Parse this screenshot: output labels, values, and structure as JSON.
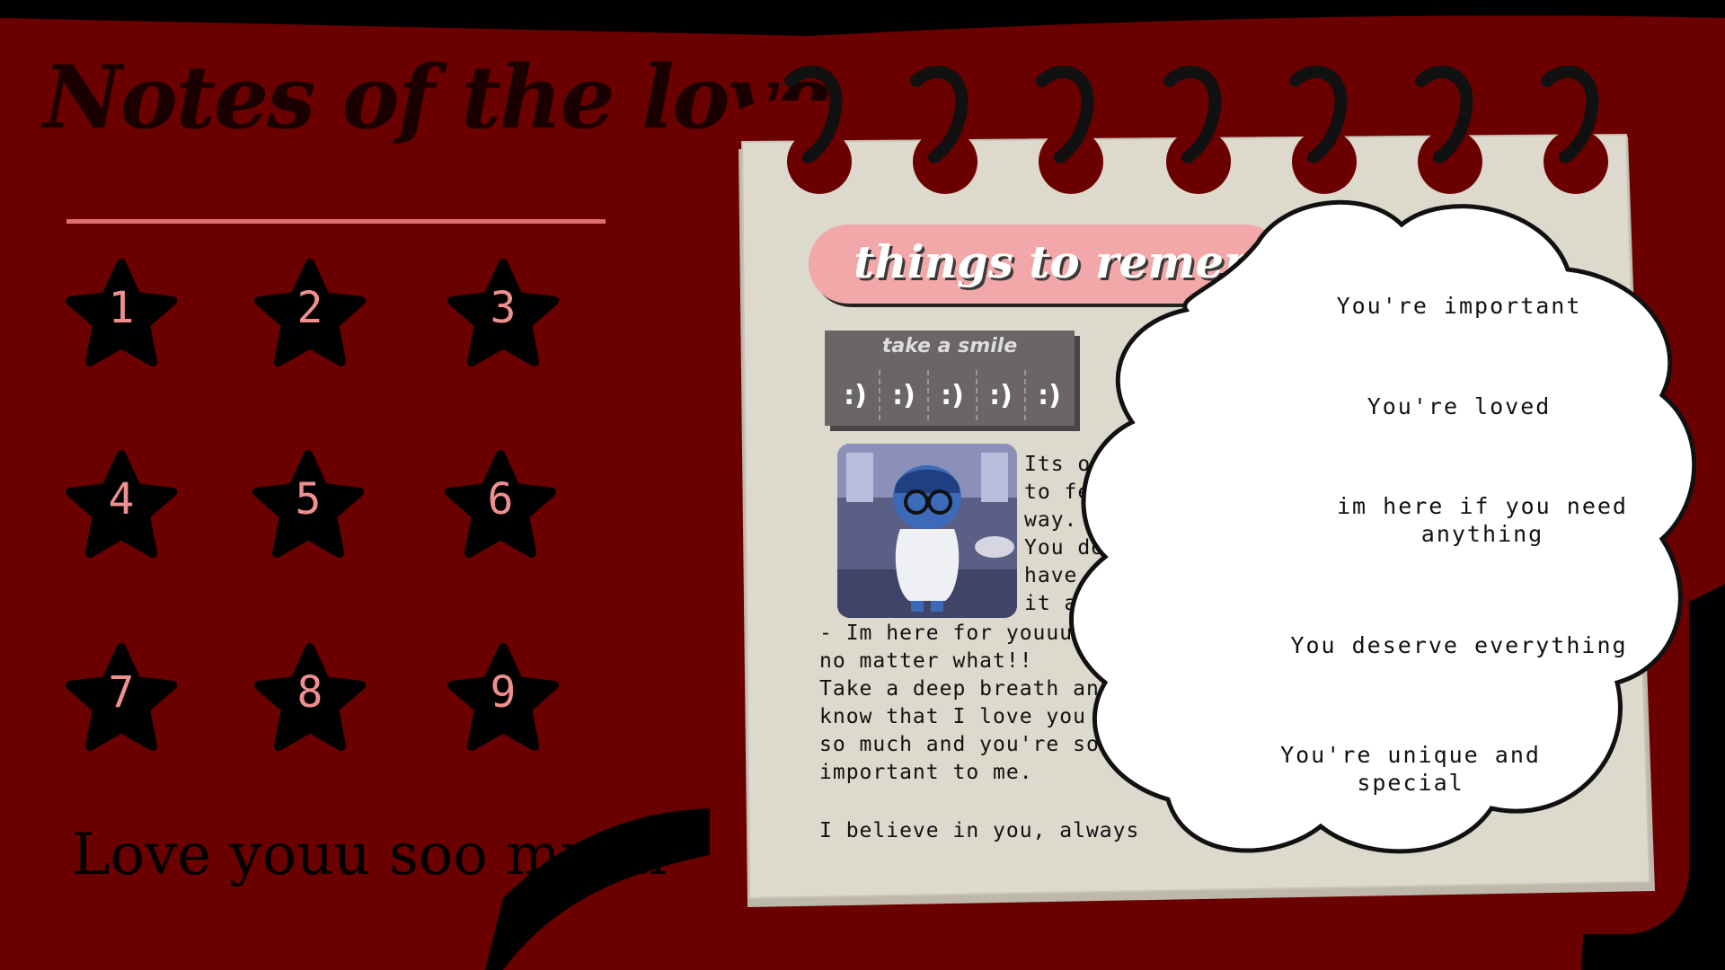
{
  "header": {
    "title": "Notes of the love"
  },
  "stars": [
    {
      "label": "1"
    },
    {
      "label": "2"
    },
    {
      "label": "3"
    },
    {
      "label": "4"
    },
    {
      "label": "5"
    },
    {
      "label": "6"
    },
    {
      "label": "7"
    },
    {
      "label": "8"
    },
    {
      "label": "9"
    }
  ],
  "footer": {
    "message": "Love youu soo much"
  },
  "notebook": {
    "banner": "things to remember",
    "smile_box": {
      "title": "take a smile",
      "tabs": [
        ":)",
        ":)",
        ":)",
        ":)",
        ":)"
      ]
    },
    "note_beside_image": "Its okay\nto feel this\nway.\nYou don't\nhave to face\nit alone",
    "note_body": "- Im here for youuu,\nno matter what!!\nTake a deep breath and\nknow that I love you\nso much and you're so\nimportant to me.",
    "note_closing": "I believe in you, always"
  },
  "cloud": {
    "messages": [
      "You're important",
      "You're loved",
      "im here if you need anything",
      "You deserve everything",
      "You're unique and special"
    ]
  },
  "colors": {
    "background_red": "#6b0000",
    "accent_pink": "#f2a7a8",
    "star_number": "#f08f8f",
    "paper": "#ddd9cd"
  },
  "icons": {
    "stars": "star-icon",
    "rings": "spiral-ring-icon"
  }
}
